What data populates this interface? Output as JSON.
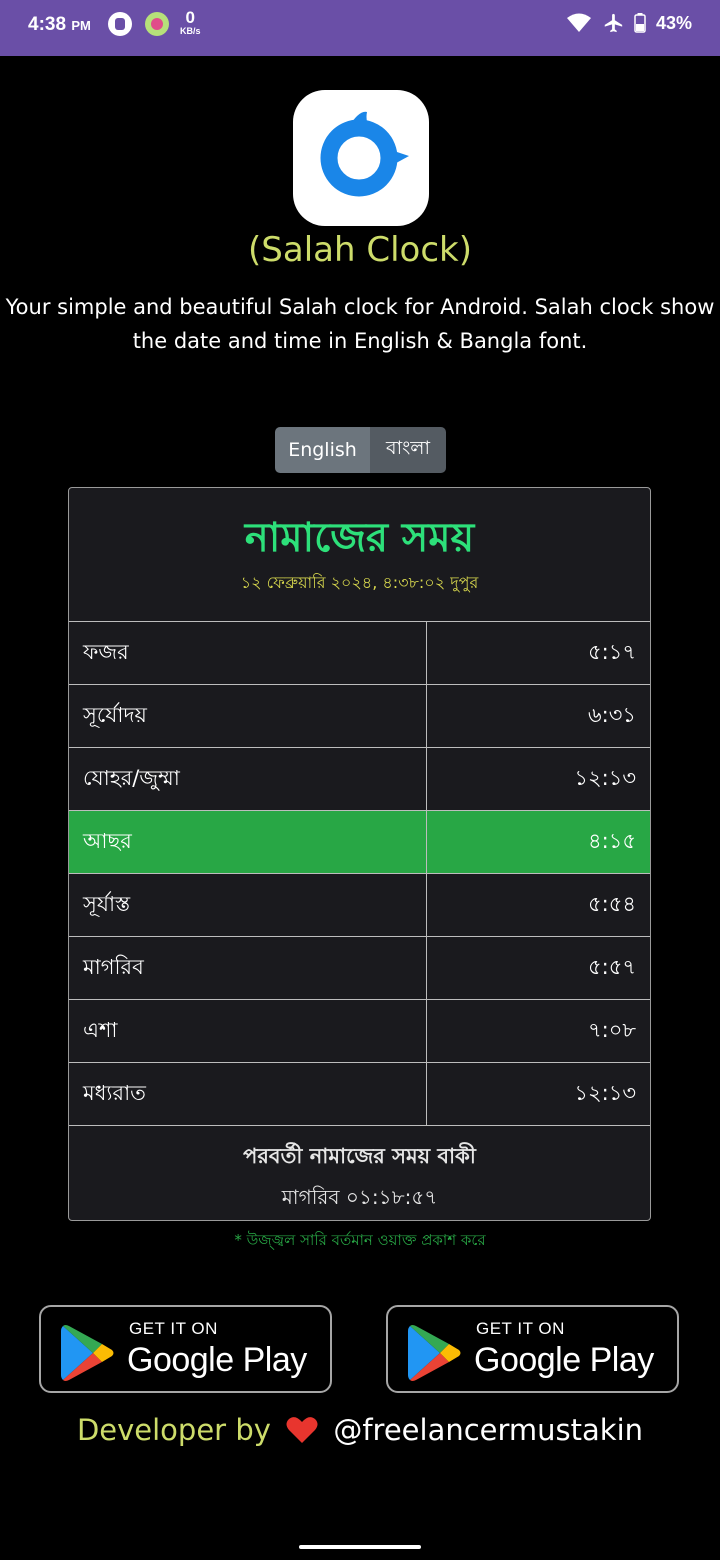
{
  "status_bar": {
    "time": "4:38",
    "ampm": "PM",
    "net_speed": "0",
    "net_unit": "KB/s",
    "battery": "43%"
  },
  "app": {
    "name": "(Salah Clock)",
    "description": "Your simple and beautiful Salah clock for Android. Salah clock show the date and time in English & Bangla font."
  },
  "language": {
    "english_label": "English",
    "bangla_label": "বাংলা"
  },
  "card": {
    "title": "নামাজের সময়",
    "datetime": "১২ ফেব্রুয়ারি ২০২৪, ৪:৩৮:০২ দুপুর",
    "prayers": [
      {
        "name": "ফজর",
        "time": "৫:১৭"
      },
      {
        "name": "সূর্যোদয়",
        "time": "৬:৩১"
      },
      {
        "name": "যোহর/জুম্মা",
        "time": "১২:১৩"
      },
      {
        "name": "আছর",
        "time": "৪:১৫"
      },
      {
        "name": "সূর্যাস্ত",
        "time": "৫:৫৪"
      },
      {
        "name": "মাগরিব",
        "time": "৫:৫৭"
      },
      {
        "name": "এশা",
        "time": "৭:০৮"
      },
      {
        "name": "মধ্যরাত",
        "time": "১২:১৩"
      }
    ],
    "active_index": 3,
    "next_label": "পরবর্তী নামাজের সময় বাকী",
    "next_value": "মাগরিব ০১:১৮:৫৭"
  },
  "footnote": "* উজ্জ্বল সারি বর্তমান ওয়াক্ত প্রকাশ করে",
  "play_badges": {
    "small_text": "GET IT ON",
    "big_text": "Google Play"
  },
  "developer": {
    "prefix": "Developer by",
    "handle": "@freelancermustakin"
  },
  "colors": {
    "status_bar": "#6a4fa7",
    "title_green": "#2de07a",
    "active_row": "#28a745",
    "app_name": "#cddc6a"
  }
}
